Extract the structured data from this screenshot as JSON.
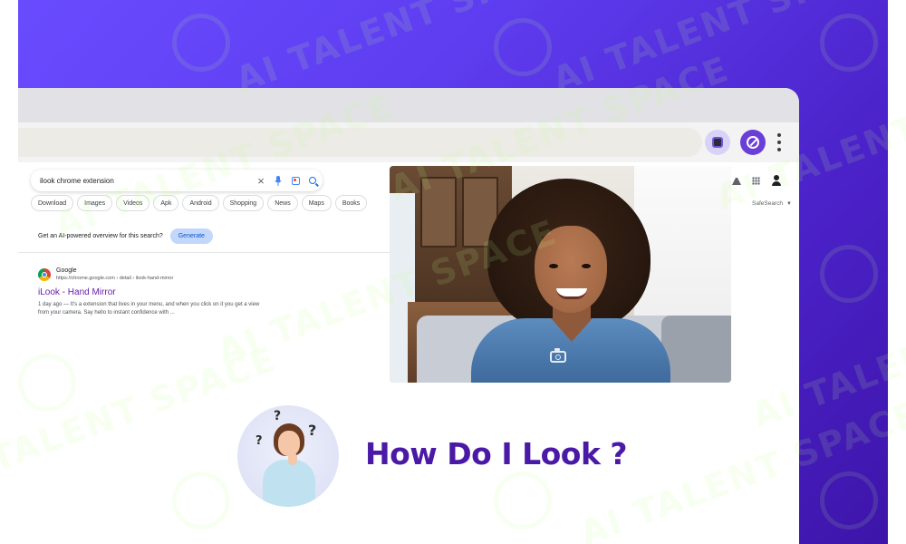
{
  "search": {
    "query": "ilook chrome extension"
  },
  "filter_chips": [
    "Download",
    "Images",
    "Videos",
    "Apk",
    "Android",
    "Shopping",
    "News",
    "Maps",
    "Books"
  ],
  "ai_overview": {
    "prompt": "Get an AI-powered overview for this search?",
    "button_label": "Generate"
  },
  "result": {
    "site_name": "Google",
    "url": "https://chrome.google.com › detail › ilook-hand-mirror",
    "title": "iLook - Hand Mirror",
    "snippet_line1": "1 day ago — It's a extension that lives in your menu, and when you click on it you get a view",
    "snippet_line2": "from your camera. Say hello to instant confidence with ..."
  },
  "toolbar": {
    "safesearch_label": "SafeSearch"
  },
  "promo": {
    "headline": "How Do I Look ?",
    "watermark_text": "AI TALENT SPACE"
  },
  "colors": {
    "background_gradient_start": "#6a4cff",
    "background_gradient_end": "#3d14a8",
    "headline": "#4a1aa6",
    "result_title": "#681da8",
    "generate_button": "#c2d7fb"
  }
}
